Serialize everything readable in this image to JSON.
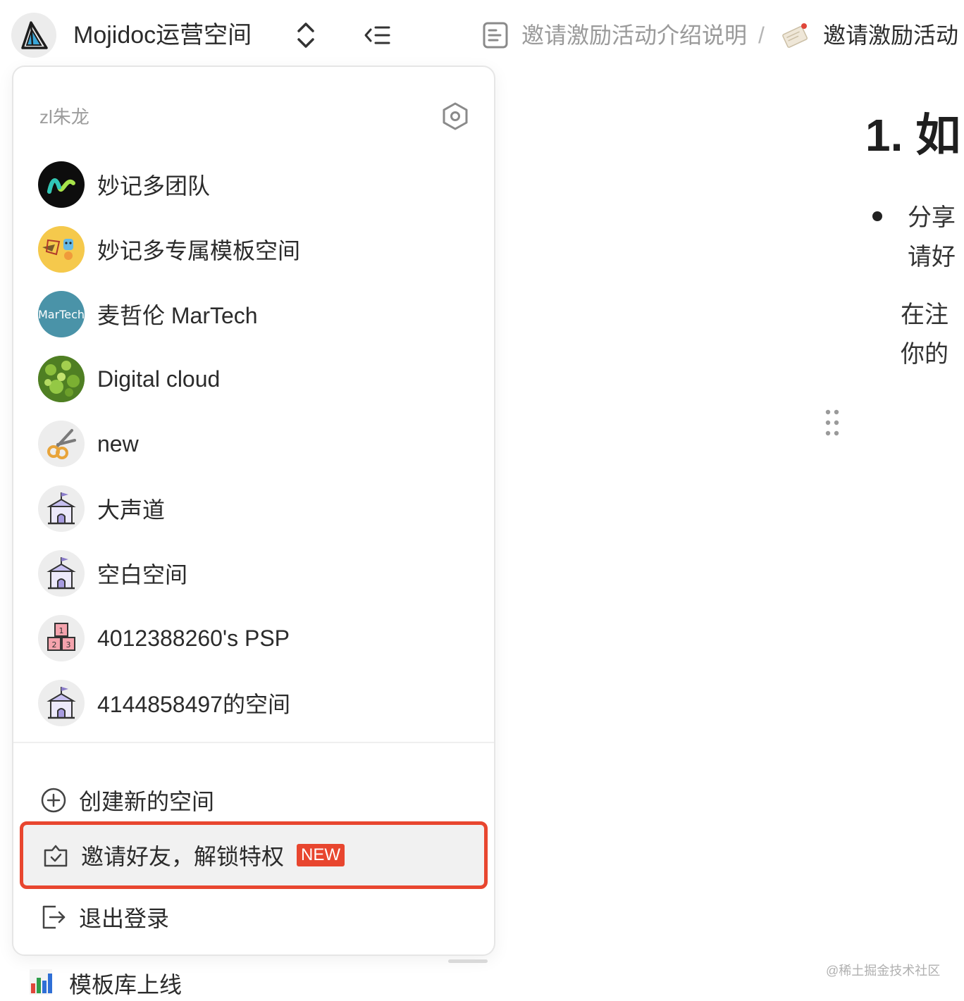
{
  "header": {
    "workspace_name": "Mojidoc运营空间",
    "breadcrumb": {
      "parent": "邀请激励活动介绍说明",
      "separator": "/",
      "current": "邀请激励活动"
    }
  },
  "menu": {
    "user": "zl朱龙",
    "spaces": [
      {
        "name": "妙记多团队",
        "avatar": "moji-logo"
      },
      {
        "name": "妙记多专属模板空间",
        "avatar": "template-art"
      },
      {
        "name": "麦哲伦 MarTech",
        "avatar": "martech-badge",
        "avatar_text": "MarTech"
      },
      {
        "name": "Digital cloud",
        "avatar": "green-foliage"
      },
      {
        "name": "new",
        "avatar": "scissors-emoji"
      },
      {
        "name": "大声道",
        "avatar": "school-emoji"
      },
      {
        "name": "空白空间",
        "avatar": "school-emoji"
      },
      {
        "name": "4012388260's PSP",
        "avatar": "blocks-emoji",
        "avatar_digits": [
          "1",
          "2",
          "3"
        ]
      },
      {
        "name": "4144858497的空间",
        "avatar": "school-emoji"
      }
    ],
    "actions": {
      "create": "创建新的空间",
      "invite": "邀请好友，解锁特权",
      "invite_badge": "NEW",
      "logout": "退出登录"
    },
    "bottom_item": "模板库上线"
  },
  "document": {
    "heading": "1. 如",
    "bullet_line1": "分享",
    "bullet_line2": "请好",
    "para_line1": "在注",
    "para_line2": "你的"
  },
  "watermark": "@稀土掘金技术社区",
  "colors": {
    "highlight_border": "#e8462f",
    "badge_bg": "#e8462f",
    "martech_avatar": "#4a93a8"
  }
}
